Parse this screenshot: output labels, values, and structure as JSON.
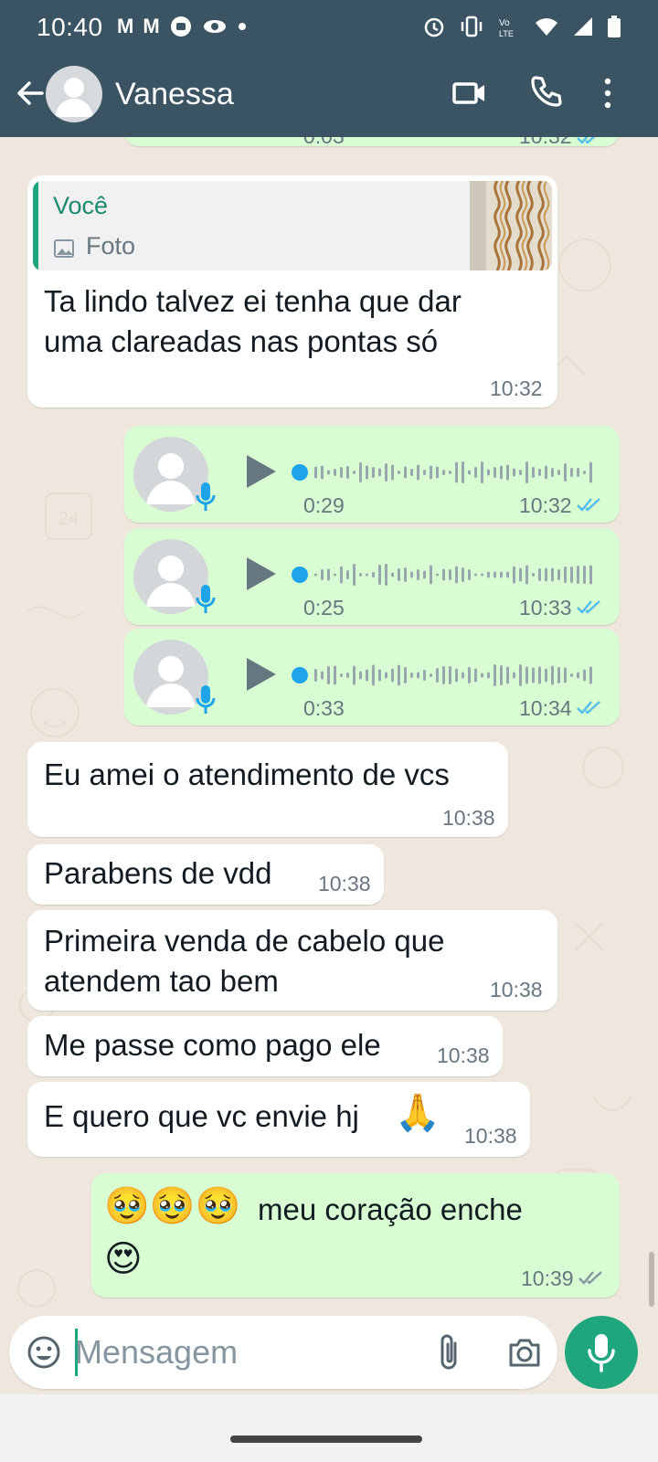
{
  "status_bar": {
    "time": "10:40",
    "notifications": [
      "M",
      "M"
    ]
  },
  "header": {
    "contact_name": "Vanessa"
  },
  "chat": {
    "partial_top": {
      "duration": "0:03",
      "time": "10:32"
    },
    "reply_message": {
      "quote_author": "Você",
      "quote_type": "Foto",
      "text_line1": "Ta lindo talvez ei tenha que dar",
      "text_line2": "uma clareadas nas pontas só",
      "time": "10:32"
    },
    "voice_notes": [
      {
        "duration": "0:29",
        "time": "10:32",
        "progress": 0
      },
      {
        "duration": "0:25",
        "time": "10:33",
        "progress": 0
      },
      {
        "duration": "0:33",
        "time": "10:34",
        "progress": 0
      }
    ],
    "messages": [
      {
        "text": "Eu amei o atendimento de vcs",
        "time": "10:38"
      },
      {
        "text": "Parabens de vdd",
        "time": "10:38"
      },
      {
        "text_line1": "Primeira venda de cabelo que",
        "text_line2": "atendem tao bem",
        "time": "10:38"
      },
      {
        "text": "Me passe como pago ele",
        "time": "10:38"
      },
      {
        "text": "E quero que vc envie hj",
        "emoji": "🙏",
        "time": "10:38"
      }
    ],
    "outgoing_last": {
      "emojis": "🥹🥹🥹",
      "text": "meu coração enche",
      "emoji_line2": "😍",
      "time": "10:39"
    }
  },
  "composer": {
    "placeholder": "Mensagem"
  },
  "colors": {
    "header_bg": "#3a5463",
    "incoming_bubble": "#ffffff",
    "outgoing_bubble": "#d9fdd3",
    "accent": "#1fa67e",
    "read_ticks": "#53bdeb",
    "delivered_ticks": "#8696a0"
  },
  "icons": [
    "back-arrow-icon",
    "avatar-icon",
    "video-call-icon",
    "phone-icon",
    "more-vert-icon",
    "play-icon",
    "mic-icon",
    "emoji-icon",
    "attach-icon",
    "camera-icon"
  ]
}
